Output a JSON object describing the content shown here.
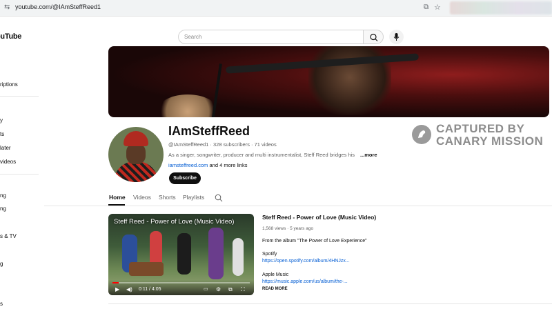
{
  "browser": {
    "url": "youtube.com/@IAmSteffReed1"
  },
  "youtube": {
    "logo": "ouTube",
    "search_placeholder": "Search"
  },
  "sidebar": {
    "items": [
      {
        "label": "riptions"
      },
      {
        "label": "y"
      },
      {
        "label": "ts"
      },
      {
        "label": "later"
      },
      {
        "label": "videos"
      },
      {
        "label": "ng"
      },
      {
        "label": "ng"
      },
      {
        "label": "s & TV"
      },
      {
        "label": "g"
      },
      {
        "label": "s"
      }
    ]
  },
  "channel": {
    "name": "IAmSteffReed",
    "meta": "@IAmSteffReed1 · 328 subscribers · 71 videos",
    "description": "As a singer, songwriter, producer and multi instrumentalist, Steff Reed bridges his love fo",
    "more": "...more",
    "link": "iamsteffreed.com",
    "more_links": "and 4 more links",
    "subscribe": "Subscribe"
  },
  "watermark": {
    "line1": "CAPTURED BY",
    "line2": "CANARY MISSION"
  },
  "tabs": [
    {
      "label": "Home"
    },
    {
      "label": "Videos"
    },
    {
      "label": "Shorts"
    },
    {
      "label": "Playlists"
    }
  ],
  "video": {
    "overlay_title": "Steff Reed - Power of Love (Music Video)",
    "time": "0:11 / 4:05",
    "progress": 0.045,
    "title": "Steff Reed - Power of Love (Music Video)",
    "meta": "1,568 views · 5 years ago",
    "desc_lines": [
      "From the album \"The Power of Love Experience\"",
      "Spotify",
      "Apple Music"
    ],
    "links": [
      "https://open.spotify.com/album/4HNJzx...",
      "https://music.apple.com/us/album/the-..."
    ],
    "read_more": "READ MORE"
  }
}
